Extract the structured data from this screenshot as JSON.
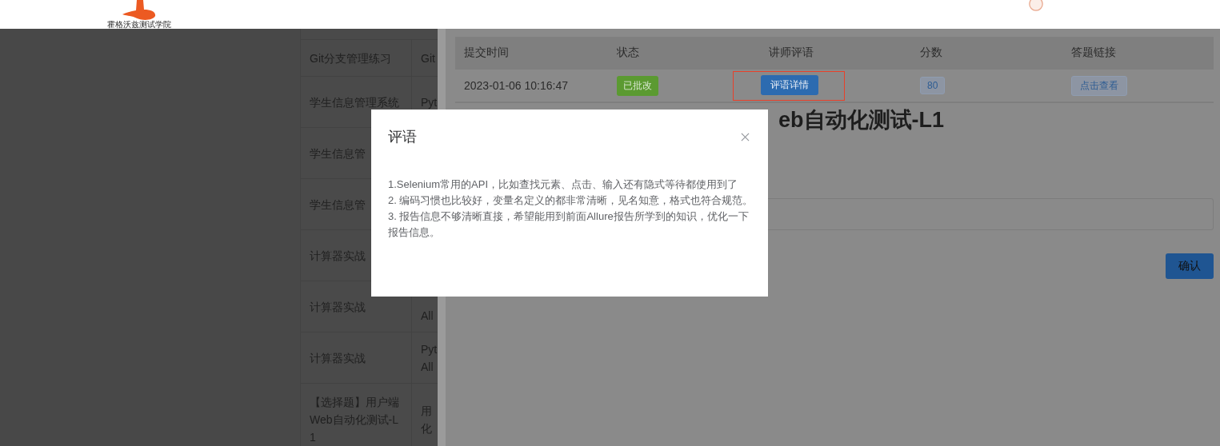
{
  "header": {
    "logo_text": "霍格沃兹测试学院"
  },
  "background_table": {
    "rows": [
      {
        "cells": [
          [
            "Git分支管理练习"
          ],
          [
            "Git"
          ]
        ]
      },
      {
        "cells": [
          [
            "学生信息管理系统"
          ],
          [
            "Pyt"
          ]
        ]
      },
      {
        "cells": [
          [
            "学生信息管"
          ],
          []
        ]
      },
      {
        "cells": [
          [
            "学生信息管"
          ],
          []
        ]
      },
      {
        "cells": [
          [
            "计算器实战"
          ],
          []
        ]
      },
      {
        "cells": [
          [
            "计算器实战"
          ],
          [
            "All"
          ]
        ]
      },
      {
        "cells": [
          [
            "计算器实战"
          ],
          [
            "Pyt",
            "All"
          ]
        ]
      },
      {
        "cells": [
          [
            "【选择题】用户端",
            "Web自动化测试-L",
            "1"
          ],
          [
            "用",
            "化"
          ]
        ]
      }
    ]
  },
  "drawer": {
    "submissions": {
      "columns": [
        "提交时间",
        "状态",
        "讲师评语",
        "分数",
        "答题链接"
      ],
      "rows": [
        {
          "submitted_at": "2023-01-06 10:16:47",
          "status": {
            "label": "已批改",
            "kind": "reviewed"
          },
          "review_button": "评语详情",
          "highlighted": true,
          "score": "80",
          "link": "点击查看"
        }
      ]
    },
    "title": "eb自动化测试-L1",
    "confirm_button": "确认"
  },
  "modal": {
    "title": "评语",
    "comments": [
      "1.Selenium常用的API，比如查找元素、点击、输入还有隐式等待都使用到了",
      "2. 编码习惯也比较好，变量名定义的都非常清晰，见名知意，格式也符合规范。",
      "3. 报告信息不够清晰直接，希望能用到前面Allure报告所学到的知识，优化一下报告信息。"
    ]
  }
}
